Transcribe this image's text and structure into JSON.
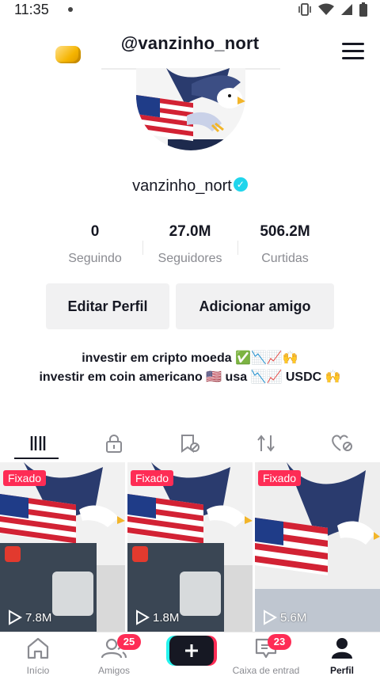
{
  "status_bar": {
    "time": "11:35"
  },
  "header": {
    "title": "@vanzinho_nort"
  },
  "profile": {
    "username": "vanzinho_nort",
    "verified": true
  },
  "stats": [
    {
      "value": "0",
      "label": "Seguindo"
    },
    {
      "value": "27.0M",
      "label": "Seguidores"
    },
    {
      "value": "506.2M",
      "label": "Curtidas"
    }
  ],
  "buttons": {
    "edit": "Editar Perfil",
    "add": "Adicionar amigo"
  },
  "bio": {
    "line1": "investir em cripto moeda ✅📉📈🙌",
    "line2": "investir em coin americano 🇺🇸 usa 📉📈 USDC 🙌"
  },
  "tabs": [
    {
      "icon": "grid-icon"
    },
    {
      "icon": "lock-icon"
    },
    {
      "icon": "bookmark-hidden-icon"
    },
    {
      "icon": "repost-icon"
    },
    {
      "icon": "liked-hidden-icon"
    }
  ],
  "videos": [
    {
      "pinned_label": "Fixado",
      "views": "7.8M"
    },
    {
      "pinned_label": "Fixado",
      "views": "1.8M"
    },
    {
      "pinned_label": "Fixado",
      "views": "5.6M"
    }
  ],
  "nav": {
    "home": "Início",
    "friends": "Amigos",
    "friends_badge": "25",
    "inbox": "Caixa de entrad",
    "inbox_badge": "23",
    "profile": "Perfil"
  },
  "colors": {
    "accent": "#fe2c55",
    "cyan": "#25f4ee",
    "verified": "#20d5ec"
  }
}
